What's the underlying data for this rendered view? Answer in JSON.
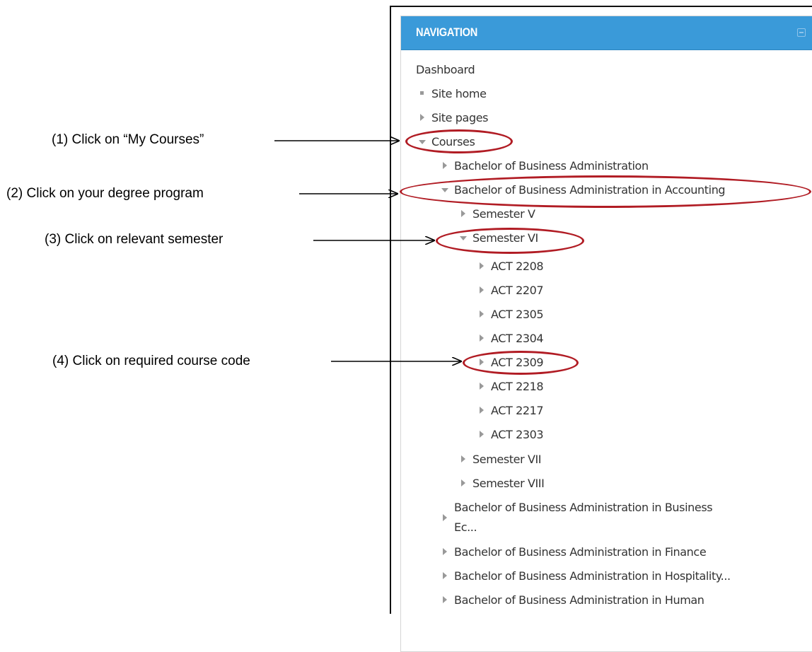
{
  "navigation": {
    "title": "NAVIGATION",
    "dashboard": "Dashboard",
    "site_home": "Site home",
    "site_pages": "Site pages",
    "courses": "Courses",
    "programs": {
      "bba": "Bachelor of Business Administration",
      "bba_accounting": "Bachelor of Business Administration in Accounting",
      "bba_business_ec_line1": "Bachelor of Business Administration in Business",
      "bba_business_ec_line2": "Ec...",
      "bba_finance": "Bachelor of Business Administration in Finance",
      "bba_hospitality": "Bachelor of Business Administration in Hospitality...",
      "bba_human": "Bachelor of Business Administration in Human"
    },
    "semesters": {
      "v": "Semester V",
      "vi": "Semester VI",
      "vii": "Semester VII",
      "viii": "Semester VIII"
    },
    "courses_list": [
      "ACT 2208",
      "ACT 2207",
      "ACT 2305",
      "ACT 2304",
      "ACT 2309",
      "ACT 2218",
      "ACT 2217",
      "ACT 2303"
    ]
  },
  "annotations": {
    "step1": "(1) Click on “My Courses”",
    "step2": "(2) Click on your degree program",
    "step3": "(3) Click on relevant semester",
    "step4": "(4) Click on required course code"
  },
  "colors": {
    "header": "#3a9ad9",
    "highlight": "#b11c24",
    "text": "#333333",
    "triangle": "#999999"
  }
}
